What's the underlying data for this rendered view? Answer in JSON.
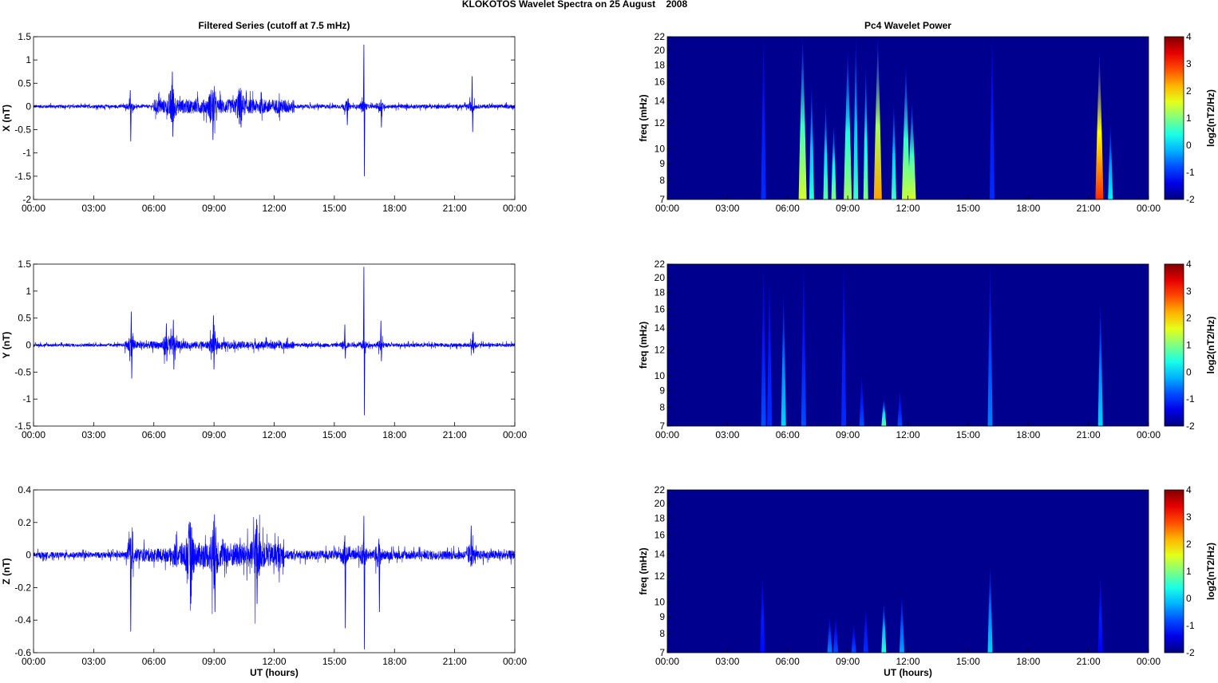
{
  "figure_title": "KLOKOTOS Wavelet Spectra on 25 August    2008",
  "colors": {
    "trace": "#0000ff",
    "background": "#00008f"
  },
  "chart_data": [
    {
      "id": "x-series",
      "type": "line",
      "title": "Filtered Series (cutoff at 7.5 mHz)",
      "ylabel": "X (nT)",
      "xlabel": "",
      "ylim": [
        -2,
        1.5
      ],
      "yticks": [
        "1.5",
        "1",
        "0.5",
        "0",
        "-0.5",
        "-1",
        "-1.5",
        "-2"
      ],
      "ytick_values": [
        1.5,
        1,
        0.5,
        0,
        -0.5,
        -1,
        -1.5,
        -2
      ],
      "xticks": [
        "00:00",
        "03:00",
        "06:00",
        "09:00",
        "12:00",
        "15:00",
        "18:00",
        "21:00",
        "00:00"
      ],
      "xlim_hours": [
        0,
        24
      ],
      "noise": [
        {
          "from": 0,
          "to": 6,
          "amp": 0.05
        },
        {
          "from": 6,
          "to": 13,
          "amp": 0.22
        },
        {
          "from": 13,
          "to": 24,
          "amp": 0.06
        }
      ],
      "spikes": [
        {
          "t": 4.8,
          "max": 0.35,
          "min": -0.75
        },
        {
          "t": 6.9,
          "max": 0.75,
          "min": -0.65
        },
        {
          "t": 8.9,
          "max": 0.3,
          "min": -0.72
        },
        {
          "t": 10.3,
          "max": 0.3,
          "min": -0.45
        },
        {
          "t": 15.6,
          "max": 0.1,
          "min": -0.4
        },
        {
          "t": 16.45,
          "max": 1.33,
          "min": -1.5
        },
        {
          "t": 17.3,
          "max": 0.15,
          "min": -0.45
        },
        {
          "t": 21.85,
          "max": 0.65,
          "min": -0.55
        }
      ]
    },
    {
      "id": "y-series",
      "type": "line",
      "title": "",
      "ylabel": "Y (nT)",
      "xlabel": "",
      "ylim": [
        -1.5,
        1.5
      ],
      "yticks": [
        "1.5",
        "1",
        "0.5",
        "0",
        "-0.5",
        "-1",
        "-1.5"
      ],
      "ytick_values": [
        1.5,
        1,
        0.5,
        0,
        -0.5,
        -1,
        -1.5
      ],
      "xticks": [
        "00:00",
        "03:00",
        "06:00",
        "09:00",
        "12:00",
        "15:00",
        "18:00",
        "21:00",
        "00:00"
      ],
      "xlim_hours": [
        0,
        24
      ],
      "noise": [
        {
          "from": 0,
          "to": 4.5,
          "amp": 0.04
        },
        {
          "from": 4.5,
          "to": 13,
          "amp": 0.1
        },
        {
          "from": 13,
          "to": 24,
          "amp": 0.05
        }
      ],
      "spikes": [
        {
          "t": 4.85,
          "max": 0.62,
          "min": -0.62
        },
        {
          "t": 6.6,
          "max": 0.4,
          "min": -0.3
        },
        {
          "t": 6.95,
          "max": 0.47,
          "min": -0.45
        },
        {
          "t": 8.95,
          "max": 0.55,
          "min": -0.45
        },
        {
          "t": 15.5,
          "max": 0.38,
          "min": -0.25
        },
        {
          "t": 16.45,
          "max": 1.45,
          "min": -1.3
        },
        {
          "t": 17.3,
          "max": 0.45,
          "min": -0.3
        },
        {
          "t": 21.9,
          "max": 0.25,
          "min": -0.15
        }
      ]
    },
    {
      "id": "z-series",
      "type": "line",
      "title": "",
      "ylabel": "Z (nT)",
      "xlabel": "UT (hours)",
      "ylim": [
        -0.6,
        0.4
      ],
      "yticks": [
        "0.4",
        "0.2",
        "0",
        "-0.2",
        "-0.4",
        "-0.6"
      ],
      "ytick_values": [
        0.4,
        0.2,
        0,
        -0.2,
        -0.4,
        -0.6
      ],
      "xticks": [
        "00:00",
        "03:00",
        "06:00",
        "09:00",
        "12:00",
        "15:00",
        "18:00",
        "21:00",
        "00:00"
      ],
      "xlim_hours": [
        0,
        24
      ],
      "noise": [
        {
          "from": 0,
          "to": 4.7,
          "amp": 0.025
        },
        {
          "from": 4.7,
          "to": 7,
          "amp": 0.06
        },
        {
          "from": 7,
          "to": 12.5,
          "amp": 0.11
        },
        {
          "from": 12.5,
          "to": 24,
          "amp": 0.04
        }
      ],
      "spikes": [
        {
          "t": 4.8,
          "max": 0.1,
          "min": -0.47
        },
        {
          "t": 7.8,
          "max": 0.2,
          "min": -0.3
        },
        {
          "t": 9.0,
          "max": 0.25,
          "min": -0.35
        },
        {
          "t": 11.1,
          "max": 0.22,
          "min": -0.3
        },
        {
          "t": 15.5,
          "max": 0.12,
          "min": -0.45
        },
        {
          "t": 16.45,
          "max": 0.24,
          "min": -0.58
        },
        {
          "t": 17.2,
          "max": 0.1,
          "min": -0.35
        },
        {
          "t": 21.8,
          "max": 0.18,
          "min": -0.05
        }
      ]
    },
    {
      "id": "x-wavelet",
      "type": "heatmap",
      "title": "Pc4 Wavelet Power",
      "ylabel": "freq (mHz)",
      "xlabel": "",
      "ylim_mhz": [
        7,
        22
      ],
      "yscale": "log",
      "yticks": [
        "22",
        "20",
        "18",
        "16",
        "14",
        "12",
        "10",
        "9",
        "8",
        "7"
      ],
      "ytick_values": [
        22,
        20,
        18,
        16,
        14,
        12,
        10,
        9,
        8,
        7
      ],
      "xticks": [
        "00:00",
        "03:00",
        "06:00",
        "09:00",
        "12:00",
        "15:00",
        "18:00",
        "21:00",
        "00:00"
      ],
      "colorbar": {
        "label": "log2(nT2/Hz)",
        "range": [
          -2,
          4
        ],
        "ticks": [
          "4",
          "3",
          "2",
          "1",
          "0",
          "-1",
          "-2"
        ]
      },
      "bursts": [
        {
          "t": 4.8,
          "fmax": 22,
          "power": -1
        },
        {
          "t": 6.75,
          "fmax": 22,
          "power": 1.5
        },
        {
          "t": 7.2,
          "fmax": 16,
          "power": 0.5
        },
        {
          "t": 7.9,
          "fmax": 14,
          "power": 0.8
        },
        {
          "t": 8.3,
          "fmax": 12,
          "power": 1
        },
        {
          "t": 9.0,
          "fmax": 20,
          "power": 1.2
        },
        {
          "t": 9.4,
          "fmax": 22,
          "power": 0.6
        },
        {
          "t": 9.9,
          "fmax": 18,
          "power": 1
        },
        {
          "t": 10.5,
          "fmax": 22,
          "power": 2.3
        },
        {
          "t": 11.3,
          "fmax": 14,
          "power": 0.6
        },
        {
          "t": 11.9,
          "fmax": 18,
          "power": 1.4
        },
        {
          "t": 12.2,
          "fmax": 14,
          "power": 1.5
        },
        {
          "t": 16.2,
          "fmax": 22,
          "power": -1
        },
        {
          "t": 21.55,
          "fmax": 20,
          "power": 3
        },
        {
          "t": 22.1,
          "fmax": 12,
          "power": 0.2
        }
      ]
    },
    {
      "id": "y-wavelet",
      "type": "heatmap",
      "title": "",
      "ylabel": "freq (mHz)",
      "xlabel": "",
      "ylim_mhz": [
        7,
        22
      ],
      "yscale": "log",
      "yticks": [
        "22",
        "20",
        "18",
        "16",
        "14",
        "12",
        "10",
        "9",
        "8",
        "7"
      ],
      "ytick_values": [
        22,
        20,
        18,
        16,
        14,
        12,
        10,
        9,
        8,
        7
      ],
      "xticks": [
        "00:00",
        "03:00",
        "06:00",
        "09:00",
        "12:00",
        "15:00",
        "18:00",
        "21:00",
        "00:00"
      ],
      "colorbar": {
        "label": "log2(nT2/Hz)",
        "range": [
          -2,
          4
        ],
        "ticks": [
          "4",
          "3",
          "2",
          "1",
          "0",
          "-1",
          "-2"
        ]
      },
      "bursts": [
        {
          "t": 4.8,
          "fmax": 22,
          "power": -0.8
        },
        {
          "t": 5.1,
          "fmax": 20,
          "power": -1
        },
        {
          "t": 5.8,
          "fmax": 18,
          "power": 0
        },
        {
          "t": 6.8,
          "fmax": 22,
          "power": -0.8
        },
        {
          "t": 8.8,
          "fmax": 22,
          "power": -1
        },
        {
          "t": 9.7,
          "fmax": 10,
          "power": -0.8
        },
        {
          "t": 10.8,
          "fmax": 8.5,
          "power": 0.8
        },
        {
          "t": 11.6,
          "fmax": 9,
          "power": -0.8
        },
        {
          "t": 16.1,
          "fmax": 22,
          "power": -0.5
        },
        {
          "t": 21.6,
          "fmax": 17,
          "power": 0
        }
      ]
    },
    {
      "id": "z-wavelet",
      "type": "heatmap",
      "title": "",
      "ylabel": "freq (mHz)",
      "xlabel": "UT (hours)",
      "ylim_mhz": [
        7,
        22
      ],
      "yscale": "log",
      "yticks": [
        "22",
        "20",
        "18",
        "16",
        "14",
        "12",
        "10",
        "9",
        "8",
        "7"
      ],
      "ytick_values": [
        22,
        20,
        18,
        16,
        14,
        12,
        10,
        9,
        8,
        7
      ],
      "xticks": [
        "00:00",
        "03:00",
        "06:00",
        "09:00",
        "12:00",
        "15:00",
        "18:00",
        "21:00",
        "00:00"
      ],
      "colorbar": {
        "label": "log2(nT2/Hz)",
        "range": [
          -2,
          4
        ],
        "ticks": [
          "4",
          "3",
          "2",
          "1",
          "0",
          "-1",
          "-2"
        ]
      },
      "bursts": [
        {
          "t": 4.75,
          "fmax": 12,
          "power": -1.2
        },
        {
          "t": 8.1,
          "fmax": 9,
          "power": -0.5
        },
        {
          "t": 8.4,
          "fmax": 9,
          "power": -0.8
        },
        {
          "t": 9.3,
          "fmax": 8.5,
          "power": -0.8
        },
        {
          "t": 9.9,
          "fmax": 9.5,
          "power": -1
        },
        {
          "t": 10.8,
          "fmax": 10,
          "power": 0.5
        },
        {
          "t": 11.7,
          "fmax": 10.5,
          "power": -0.3
        },
        {
          "t": 16.1,
          "fmax": 13,
          "power": 0
        },
        {
          "t": 21.6,
          "fmax": 12,
          "power": -1.3
        }
      ]
    }
  ]
}
